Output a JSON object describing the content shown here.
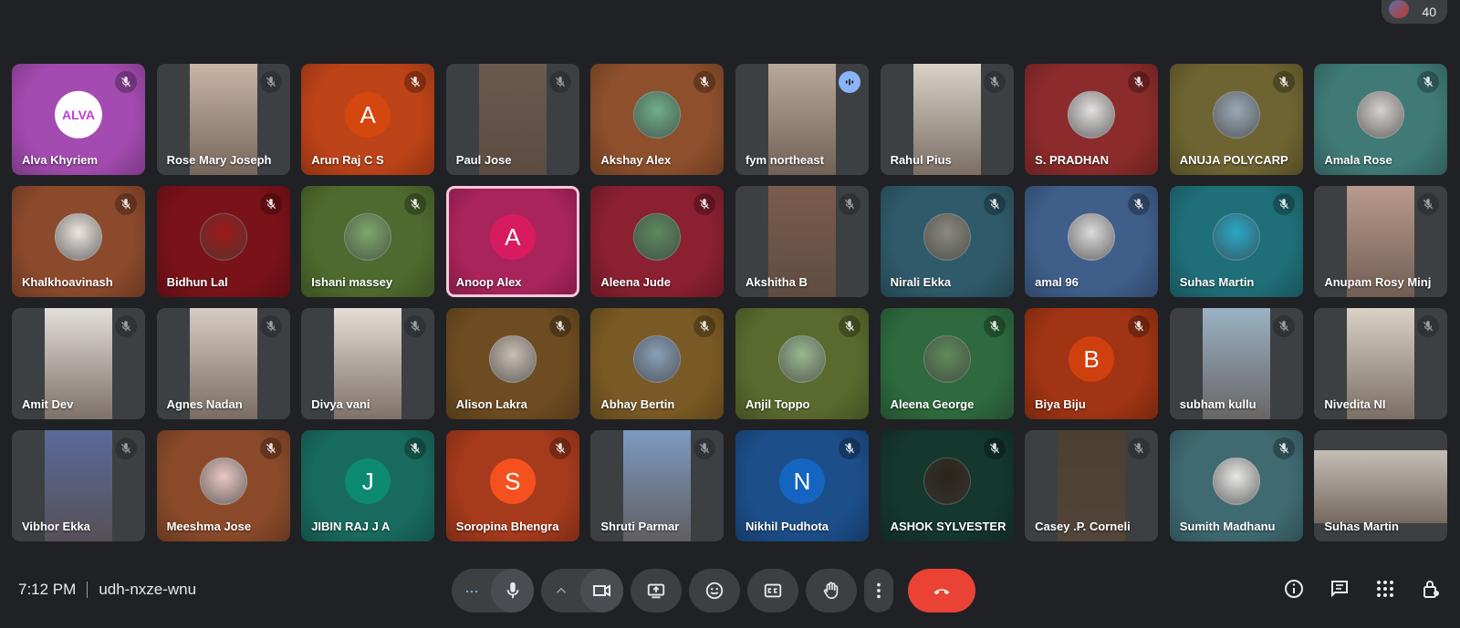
{
  "meeting": {
    "time": "7:12 PM",
    "code": "udh-nxze-wnu",
    "participant_count": "40"
  },
  "participants": [
    {
      "name": "Alva Khyriem",
      "kind": "avatar-img",
      "bg": "#a34bb0",
      "av": "#ffffff",
      "mic": "muted",
      "avatar_label": "ALVA"
    },
    {
      "name": "Rose Mary Joseph",
      "kind": "video",
      "bg": "#3c4043",
      "av": "#c9b5a6",
      "mic": "muted"
    },
    {
      "name": "Arun Raj C S",
      "kind": "letter",
      "letter": "A",
      "bg": "#bd4318",
      "av": "#d4470f",
      "mic": "muted"
    },
    {
      "name": "Paul Jose",
      "kind": "video",
      "bg": "#3c4043",
      "av": "#6b5a4e",
      "mic": "muted"
    },
    {
      "name": "Akshay Alex",
      "kind": "avatar-img",
      "bg": "#8d4f2c",
      "av": "#6fae8a",
      "mic": "muted"
    },
    {
      "name": "fym northeast",
      "kind": "video",
      "bg": "#3c4043",
      "av": "#b8a898",
      "mic": "speaking"
    },
    {
      "name": "Rahul Pius",
      "kind": "video",
      "bg": "#3c4043",
      "av": "#d8d2c8",
      "mic": "muted"
    },
    {
      "name": "S. PRADHAN",
      "kind": "avatar-img",
      "bg": "#8c2b2b",
      "av": "#e3e0df",
      "mic": "muted"
    },
    {
      "name": "ANUJA POLYCARP",
      "kind": "avatar-img",
      "bg": "#6e6432",
      "av": "#9aa8b4",
      "mic": "muted"
    },
    {
      "name": "Amala Rose",
      "kind": "avatar-img",
      "bg": "#3f7a77",
      "av": "#d7d2cf",
      "mic": "muted"
    },
    {
      "name": "Khalkhoavinash",
      "kind": "avatar-img",
      "bg": "#8c4a2c",
      "av": "#ece5e0",
      "mic": "muted"
    },
    {
      "name": "Bidhun Lal",
      "kind": "avatar-img",
      "bg": "#7a1219",
      "av": "#9e1a1a",
      "mic": "muted"
    },
    {
      "name": "Ishani massey",
      "kind": "avatar-img",
      "bg": "#4e6a2e",
      "av": "#7ea86a",
      "mic": "muted"
    },
    {
      "name": "Anoop Alex",
      "kind": "letter",
      "letter": "A",
      "bg": "#a8245a",
      "av": "#d81b60",
      "mic": "none",
      "active": true
    },
    {
      "name": "Aleena Jude",
      "kind": "avatar-img",
      "bg": "#8a2030",
      "av": "#5d8a5f",
      "mic": "muted"
    },
    {
      "name": "Akshitha B",
      "kind": "video",
      "bg": "#3c4043",
      "av": "#7a5c4d",
      "mic": "muted"
    },
    {
      "name": "Nirali Ekka",
      "kind": "avatar-img",
      "bg": "#2f5a6a",
      "av": "#8a8a80",
      "mic": "muted"
    },
    {
      "name": "amal 96",
      "kind": "avatar-img",
      "bg": "#3f5e8a",
      "av": "#dcdcdc",
      "mic": "muted"
    },
    {
      "name": "Suhas Martin",
      "kind": "avatar-img",
      "bg": "#1f6f78",
      "av": "#2aa8c7",
      "mic": "muted"
    },
    {
      "name": "Anupam Rosy Minj",
      "kind": "video",
      "bg": "#3c4043",
      "av": "#b99a8c",
      "mic": "muted"
    },
    {
      "name": "Amit Dev",
      "kind": "video",
      "bg": "#3c4043",
      "av": "#e2ded8",
      "mic": "muted"
    },
    {
      "name": "Agnes Nadan",
      "kind": "video",
      "bg": "#3c4043",
      "av": "#d6cbc2",
      "mic": "muted"
    },
    {
      "name": "Divya vani",
      "kind": "video",
      "bg": "#3c4043",
      "av": "#e4ddd5",
      "mic": "muted"
    },
    {
      "name": "Alison Lakra",
      "kind": "avatar-img",
      "bg": "#6e4c22",
      "av": "#c8bfb4",
      "mic": "muted"
    },
    {
      "name": "Abhay Bertin",
      "kind": "avatar-img",
      "bg": "#7a5a24",
      "av": "#8aa0b8",
      "mic": "muted"
    },
    {
      "name": "Anjil Toppo",
      "kind": "avatar-img",
      "bg": "#5a6a2e",
      "av": "#9ab890",
      "mic": "muted"
    },
    {
      "name": "Aleena George",
      "kind": "avatar-img",
      "bg": "#2e6a3e",
      "av": "#5f8a5a",
      "mic": "muted"
    },
    {
      "name": "Biya Biju",
      "kind": "letter",
      "letter": "B",
      "bg": "#a03414",
      "av": "#d0400f",
      "mic": "muted"
    },
    {
      "name": "subham kullu",
      "kind": "video",
      "bg": "#3c4043",
      "av": "#9ab2c4",
      "mic": "muted"
    },
    {
      "name": "Nivedita NI",
      "kind": "video",
      "bg": "#3c4043",
      "av": "#d9d2c4",
      "mic": "muted"
    },
    {
      "name": "Vibhor Ekka",
      "kind": "video",
      "bg": "#3c4043",
      "av": "#5a6a9a",
      "mic": "muted"
    },
    {
      "name": "Meeshma Jose",
      "kind": "avatar-img",
      "bg": "#8a4a2a",
      "av": "#e8c8c4",
      "mic": "muted"
    },
    {
      "name": "JIBIN RAJ J A",
      "kind": "letter",
      "letter": "J",
      "bg": "#196a5e",
      "av": "#0f8a72",
      "mic": "muted"
    },
    {
      "name": "Soropina Bhengra",
      "kind": "letter",
      "letter": "S",
      "bg": "#a63a1c",
      "av": "#f4511e",
      "mic": "muted"
    },
    {
      "name": "Shruti Parmar",
      "kind": "video",
      "bg": "#3c4043",
      "av": "#7d9ac0",
      "mic": "muted"
    },
    {
      "name": "Nikhil Pudhota",
      "kind": "letter",
      "letter": "N",
      "bg": "#1c4e8a",
      "av": "#1565c0",
      "mic": "muted"
    },
    {
      "name": "ASHOK SYLVESTER",
      "kind": "avatar-img",
      "bg": "#14372e",
      "av": "#2a241a",
      "mic": "muted"
    },
    {
      "name": "Casey .P. Corneli",
      "kind": "video",
      "bg": "#3c4043",
      "av": "#4a4030",
      "mic": "muted"
    },
    {
      "name": "Sumith Madhanu",
      "kind": "avatar-img",
      "bg": "#3f6a72",
      "av": "#e8e8e6",
      "mic": "muted"
    },
    {
      "name": "Suhas Martin",
      "kind": "video-wide",
      "bg": "#3c4043",
      "av": "#c4beb6",
      "mic": "none"
    }
  ],
  "controls": {
    "more_dots": "···",
    "items": [
      "more-options",
      "microphone",
      "chevron-up",
      "camera",
      "present",
      "emoji",
      "captions",
      "raise-hand",
      "more-vert",
      "end-call"
    ]
  },
  "colors": {
    "end_call": "#ea4335",
    "speaking": "#8ab4f8",
    "background": "#202124"
  }
}
